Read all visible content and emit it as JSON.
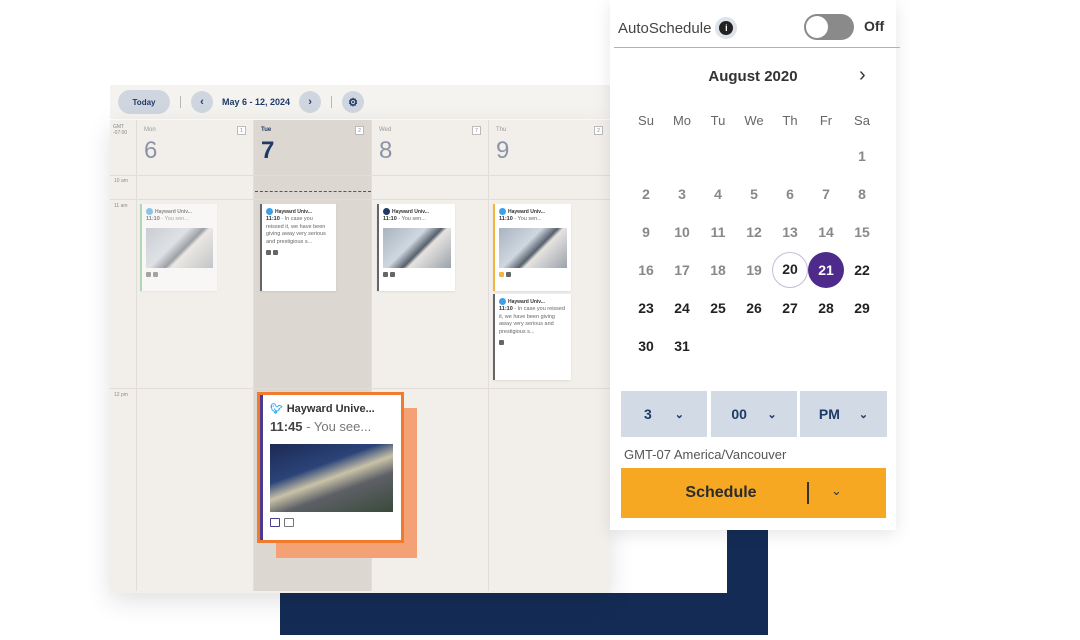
{
  "toolbar": {
    "today_label": "Today",
    "prev_icon": "chevron-left-icon",
    "range": "May 6 - 12, 2024",
    "next_icon": "chevron-right-icon",
    "settings_icon": "gear-icon"
  },
  "week": {
    "timezone": "GMT -07:00",
    "time_labels": [
      "10 am",
      "11 am",
      "12 pm"
    ],
    "days": [
      {
        "name": "Mon",
        "num": "6",
        "count": "1"
      },
      {
        "name": "Tue",
        "num": "7",
        "count": "2"
      },
      {
        "name": "Wed",
        "num": "8",
        "count": "7"
      },
      {
        "name": "Thu",
        "num": "9",
        "count": "2"
      }
    ]
  },
  "cards": [
    {
      "account": "Hayward Univ...",
      "time": "11:10",
      "text": " - You sen..."
    },
    {
      "account": "Hayward Univ...",
      "time": "11:10",
      "text": " - In case you reissed it, we have been giving away very serious and prestigious s..."
    },
    {
      "account": "Hayward Univ...",
      "time": "11:10",
      "text": " - You sen..."
    },
    {
      "account": "Hayward Univ...",
      "time": "11:10",
      "text": " - You sen..."
    },
    {
      "account": "Hayward Univ...",
      "time": "11:10",
      "text": " - In case you reissed it, we have been giving away very serious and prestigious s..."
    }
  ],
  "highlight_card": {
    "network_icon": "twitter-icon",
    "account": "Hayward Unive...",
    "time": "11:45",
    "text": " - You see...",
    "icons": [
      "calendar-icon",
      "image-icon"
    ]
  },
  "picker": {
    "autoschedule_label": "AutoSchedule",
    "info_icon": "i",
    "toggle_state": "Off",
    "month": "August 2020",
    "next_icon": "›",
    "weekdays": [
      "Su",
      "Mo",
      "Tu",
      "We",
      "Th",
      "Fr",
      "Sa"
    ],
    "first_weekday_index": 6,
    "days_in_month": 31,
    "current_day": 20,
    "selected_day": 21,
    "hour": "3",
    "minute": "00",
    "ampm": "PM",
    "timezone": "GMT-07 America/Vancouver",
    "schedule_label": "Schedule",
    "colors": {
      "selected": "#4e2a8a",
      "schedule_button": "#f6a823",
      "highlight_border": "#f07a2e",
      "navy": "#142c55"
    }
  }
}
